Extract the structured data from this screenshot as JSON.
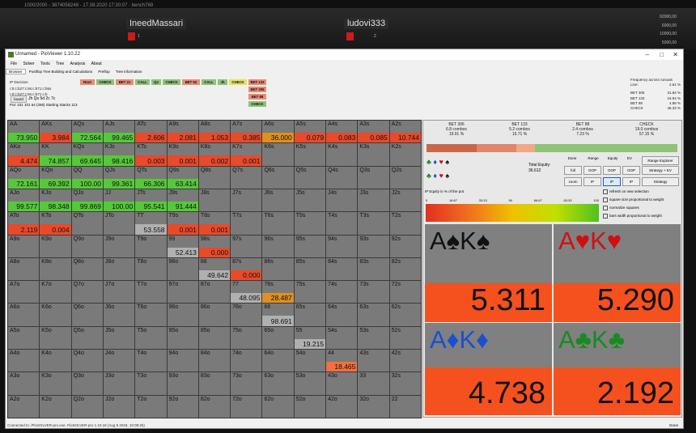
{
  "window_info": "1000/2000 - 3874058248 - 17.08.2020 17:30:07 - bench769",
  "players": [
    {
      "name": "IneedMassari",
      "amount": "1"
    },
    {
      "name": "ludovi333",
      "amount": "2"
    }
  ],
  "stacks": [
    "62000,00",
    "6000,00",
    "10000,00",
    "5000,00"
  ],
  "app": {
    "title": "Unnamed - PioViewer 1.10.22",
    "menu": [
      "File",
      "Solver",
      "Tools",
      "Tree",
      "Analysis",
      "About"
    ],
    "tabs": [
      "Browser",
      "Postflop Tree Building and Calculations",
      "Preflop",
      "Tree information"
    ],
    "ip_decision": [
      "IP Decision",
      "r:0:c:b27:c:8s:c:b71:c:b5s",
      "r:0:c:b27:c:8s:c:b71:c:b"
    ],
    "board_button": "board",
    "board_cards": "Jh Qs 5d 2c 7c",
    "pot": "Pot: 101 101 64 (266) Starting Stacks 113",
    "action_line": [
      {
        "label": "Root",
        "color": "#e88c74"
      },
      {
        "label": "CHECK",
        "color": "#8fc27a"
      },
      {
        "label": "BET 21",
        "color": "#e88c74"
      },
      {
        "label": "CALL",
        "color": "#8fc27a"
      },
      {
        "label": "Qs",
        "color": "#8fc27a"
      },
      {
        "label": "CHECK",
        "color": "#8fc27a"
      },
      {
        "label": "BET 62",
        "color": "#e88c74"
      },
      {
        "label": "CALL",
        "color": "#8fc27a"
      },
      {
        "label": "Jh",
        "color": "#8fc27a"
      },
      {
        "label": "CHECK",
        "color": "#e8e060"
      },
      {
        "label": "BET 133",
        "color": "#e88c74"
      },
      {
        "label": "BET 306",
        "color": "#e88c74"
      },
      {
        "label": "BET 88",
        "color": "#e88c74"
      },
      {
        "label": "CHECK",
        "color": "#8fc27a"
      }
    ],
    "frequency": {
      "title": "Frequency across runouts",
      "line_label": "Line:",
      "line_value": "2.61 %",
      "rows": [
        [
          "BET 306",
          "31.84 %"
        ],
        [
          "BET 133",
          "16.94 %"
        ],
        [
          "BET 88",
          "4.88 %"
        ],
        [
          "CHECK",
          "46.33 %"
        ]
      ]
    },
    "grid": [
      [
        {
          "h": "AA",
          "v": "73.950",
          "c": "#56c83a"
        },
        {
          "h": "AKs",
          "v": "3.984",
          "c": "#e84a2a"
        },
        {
          "h": "AQs",
          "v": "72.564",
          "c": "#56c83a"
        },
        {
          "h": "AJs",
          "v": "99.465",
          "c": "#56c83a"
        },
        {
          "h": "ATs",
          "v": "2.606",
          "c": "#e84a2a"
        },
        {
          "h": "A9s",
          "v": "2.081",
          "c": "#e84a2a"
        },
        {
          "h": "A8s",
          "v": "1.053",
          "c": "#e84a2a"
        },
        {
          "h": "A7s",
          "v": "0.385",
          "c": "#e84a2a"
        },
        {
          "h": "A6s",
          "v": "36.000",
          "c": "#e09020"
        },
        {
          "h": "A5s",
          "v": "0.079",
          "c": "#e84a2a"
        },
        {
          "h": "A4s",
          "v": "0.083",
          "c": "#e84a2a"
        },
        {
          "h": "A3s",
          "v": "0.085",
          "c": "#e84a2a"
        },
        {
          "h": "A2s",
          "v": "10.744",
          "c": "#e84a2a"
        }
      ],
      [
        {
          "h": "AKo",
          "v": "4.474",
          "c": "#e84a2a"
        },
        {
          "h": "KK",
          "v": "74.857",
          "c": "#56c83a"
        },
        {
          "h": "KQs",
          "v": "69.645",
          "c": "#56c83a"
        },
        {
          "h": "KJs",
          "v": "98.416",
          "c": "#56c83a"
        },
        {
          "h": "KTs",
          "v": "0.003",
          "c": "#e84a2a"
        },
        {
          "h": "K9s",
          "v": "0.001",
          "c": "#e84a2a"
        },
        {
          "h": "K8s",
          "v": "0.002",
          "c": "#e84a2a"
        },
        {
          "h": "K7s",
          "v": "0.001",
          "c": "#e84a2a"
        },
        {
          "h": "K6s",
          "v": "",
          "c": ""
        },
        {
          "h": "K5s",
          "v": "",
          "c": ""
        },
        {
          "h": "K4s",
          "v": "",
          "c": ""
        },
        {
          "h": "K3s",
          "v": "",
          "c": ""
        },
        {
          "h": "K2s",
          "v": "",
          "c": ""
        }
      ],
      [
        {
          "h": "AQo",
          "v": "72.161",
          "c": "#56c83a"
        },
        {
          "h": "KQo",
          "v": "69.392",
          "c": "#56c83a"
        },
        {
          "h": "QQ",
          "v": "100.00",
          "c": "#56c83a"
        },
        {
          "h": "QJs",
          "v": "99.361",
          "c": "#56c83a"
        },
        {
          "h": "QTs",
          "v": "66.306",
          "c": "#56c83a"
        },
        {
          "h": "Q9s",
          "v": "63.414",
          "c": "#56c83a"
        },
        {
          "h": "Q8s",
          "v": "",
          "c": ""
        },
        {
          "h": "Q7s",
          "v": "",
          "c": ""
        },
        {
          "h": "Q6s",
          "v": "",
          "c": ""
        },
        {
          "h": "Q5s",
          "v": "",
          "c": ""
        },
        {
          "h": "Q4s",
          "v": "",
          "c": ""
        },
        {
          "h": "Q3s",
          "v": "",
          "c": ""
        },
        {
          "h": "Q2s",
          "v": "",
          "c": ""
        }
      ],
      [
        {
          "h": "AJo",
          "v": "99.577",
          "c": "#56c83a"
        },
        {
          "h": "KJo",
          "v": "98.348",
          "c": "#56c83a"
        },
        {
          "h": "QJo",
          "v": "99.869",
          "c": "#56c83a"
        },
        {
          "h": "JJ",
          "v": "100.00",
          "c": "#56c83a"
        },
        {
          "h": "JTs",
          "v": "95.541",
          "c": "#56c83a"
        },
        {
          "h": "J9s",
          "v": "91.444",
          "c": "#56c83a"
        },
        {
          "h": "J8s",
          "v": "",
          "c": ""
        },
        {
          "h": "J7s",
          "v": "",
          "c": ""
        },
        {
          "h": "J6s",
          "v": "",
          "c": ""
        },
        {
          "h": "J5s",
          "v": "",
          "c": ""
        },
        {
          "h": "J4s",
          "v": "",
          "c": ""
        },
        {
          "h": "J3s",
          "v": "",
          "c": ""
        },
        {
          "h": "J2s",
          "v": "",
          "c": ""
        }
      ],
      [
        {
          "h": "ATo",
          "v": "2.119",
          "c": "#e84a2a"
        },
        {
          "h": "KTo",
          "v": "0.004",
          "c": "#e84a2a"
        },
        {
          "h": "QTo",
          "v": "",
          "c": ""
        },
        {
          "h": "JTo",
          "v": "",
          "c": ""
        },
        {
          "h": "TT",
          "v": "53.558",
          "c": "#b0b0b0"
        },
        {
          "h": "T9s",
          "v": "0.001",
          "c": "#e84a2a"
        },
        {
          "h": "T8s",
          "v": "0.001",
          "c": "#e84a2a"
        },
        {
          "h": "T7s",
          "v": "",
          "c": ""
        },
        {
          "h": "T6s",
          "v": "",
          "c": ""
        },
        {
          "h": "T5s",
          "v": "",
          "c": ""
        },
        {
          "h": "T4s",
          "v": "",
          "c": ""
        },
        {
          "h": "T3s",
          "v": "",
          "c": ""
        },
        {
          "h": "T2s",
          "v": "",
          "c": ""
        }
      ],
      [
        {
          "h": "A9o",
          "v": "",
          "c": ""
        },
        {
          "h": "K9o",
          "v": "",
          "c": ""
        },
        {
          "h": "Q9o",
          "v": "",
          "c": ""
        },
        {
          "h": "J9o",
          "v": "",
          "c": ""
        },
        {
          "h": "T9o",
          "v": "",
          "c": ""
        },
        {
          "h": "99",
          "v": "52.413",
          "c": "#b0b0b0"
        },
        {
          "h": "98s",
          "v": "0.000",
          "c": "#e84a2a"
        },
        {
          "h": "97s",
          "v": "",
          "c": ""
        },
        {
          "h": "96s",
          "v": "",
          "c": ""
        },
        {
          "h": "95s",
          "v": "",
          "c": ""
        },
        {
          "h": "94s",
          "v": "",
          "c": ""
        },
        {
          "h": "93s",
          "v": "",
          "c": ""
        },
        {
          "h": "92s",
          "v": "",
          "c": ""
        }
      ],
      [
        {
          "h": "A8o",
          "v": "",
          "c": ""
        },
        {
          "h": "K8o",
          "v": "",
          "c": ""
        },
        {
          "h": "Q8o",
          "v": "",
          "c": ""
        },
        {
          "h": "J8o",
          "v": "",
          "c": ""
        },
        {
          "h": "T8o",
          "v": "",
          "c": ""
        },
        {
          "h": "98o",
          "v": "",
          "c": ""
        },
        {
          "h": "88",
          "v": "49.642",
          "c": "#b0b0b0"
        },
        {
          "h": "87s",
          "v": "0.000",
          "c": "#e84a2a"
        },
        {
          "h": "86s",
          "v": "",
          "c": ""
        },
        {
          "h": "85s",
          "v": "",
          "c": ""
        },
        {
          "h": "84s",
          "v": "",
          "c": ""
        },
        {
          "h": "83s",
          "v": "",
          "c": ""
        },
        {
          "h": "82s",
          "v": "",
          "c": ""
        }
      ],
      [
        {
          "h": "A7o",
          "v": "",
          "c": ""
        },
        {
          "h": "K7o",
          "v": "",
          "c": ""
        },
        {
          "h": "Q7o",
          "v": "",
          "c": ""
        },
        {
          "h": "J7o",
          "v": "",
          "c": ""
        },
        {
          "h": "T7o",
          "v": "",
          "c": ""
        },
        {
          "h": "97o",
          "v": "",
          "c": ""
        },
        {
          "h": "87o",
          "v": "",
          "c": ""
        },
        {
          "h": "77",
          "v": "48.095",
          "c": "#b0b0b0"
        },
        {
          "h": "76s",
          "v": "28.487",
          "c": "#e09020"
        },
        {
          "h": "75s",
          "v": "",
          "c": ""
        },
        {
          "h": "74s",
          "v": "",
          "c": ""
        },
        {
          "h": "73s",
          "v": "",
          "c": ""
        },
        {
          "h": "72s",
          "v": "",
          "c": ""
        }
      ],
      [
        {
          "h": "A6o",
          "v": "",
          "c": ""
        },
        {
          "h": "K6o",
          "v": "",
          "c": ""
        },
        {
          "h": "Q6o",
          "v": "",
          "c": ""
        },
        {
          "h": "J6o",
          "v": "",
          "c": ""
        },
        {
          "h": "T6o",
          "v": "",
          "c": ""
        },
        {
          "h": "96o",
          "v": "",
          "c": ""
        },
        {
          "h": "86o",
          "v": "",
          "c": ""
        },
        {
          "h": "76o",
          "v": "",
          "c": ""
        },
        {
          "h": "66",
          "v": "98.691",
          "c": "#b0b0b0"
        },
        {
          "h": "65s",
          "v": "",
          "c": ""
        },
        {
          "h": "64s",
          "v": "",
          "c": ""
        },
        {
          "h": "63s",
          "v": "",
          "c": ""
        },
        {
          "h": "62s",
          "v": "",
          "c": ""
        }
      ],
      [
        {
          "h": "A5o",
          "v": "",
          "c": ""
        },
        {
          "h": "K5o",
          "v": "",
          "c": ""
        },
        {
          "h": "Q5o",
          "v": "",
          "c": ""
        },
        {
          "h": "J5o",
          "v": "",
          "c": ""
        },
        {
          "h": "T5o",
          "v": "",
          "c": ""
        },
        {
          "h": "95o",
          "v": "",
          "c": ""
        },
        {
          "h": "85o",
          "v": "",
          "c": ""
        },
        {
          "h": "75o",
          "v": "",
          "c": ""
        },
        {
          "h": "65o",
          "v": "",
          "c": ""
        },
        {
          "h": "55",
          "v": "19.215",
          "c": "#b0b0b0"
        },
        {
          "h": "54s",
          "v": "",
          "c": ""
        },
        {
          "h": "53s",
          "v": "",
          "c": ""
        },
        {
          "h": "52s",
          "v": "",
          "c": ""
        }
      ],
      [
        {
          "h": "A4o",
          "v": "",
          "c": ""
        },
        {
          "h": "K4o",
          "v": "",
          "c": ""
        },
        {
          "h": "Q4o",
          "v": "",
          "c": ""
        },
        {
          "h": "J4o",
          "v": "",
          "c": ""
        },
        {
          "h": "T4o",
          "v": "",
          "c": ""
        },
        {
          "h": "94o",
          "v": "",
          "c": ""
        },
        {
          "h": "84o",
          "v": "",
          "c": ""
        },
        {
          "h": "74o",
          "v": "",
          "c": ""
        },
        {
          "h": "64o",
          "v": "",
          "c": ""
        },
        {
          "h": "54o",
          "v": "",
          "c": ""
        },
        {
          "h": "44",
          "v": "18.465",
          "c": "#f07040"
        },
        {
          "h": "43s",
          "v": "",
          "c": ""
        },
        {
          "h": "42s",
          "v": "",
          "c": ""
        }
      ],
      [
        {
          "h": "A3o",
          "v": "",
          "c": ""
        },
        {
          "h": "K3o",
          "v": "",
          "c": ""
        },
        {
          "h": "Q3o",
          "v": "",
          "c": ""
        },
        {
          "h": "J3o",
          "v": "",
          "c": ""
        },
        {
          "h": "T3o",
          "v": "",
          "c": ""
        },
        {
          "h": "93o",
          "v": "",
          "c": ""
        },
        {
          "h": "83o",
          "v": "",
          "c": ""
        },
        {
          "h": "73o",
          "v": "",
          "c": ""
        },
        {
          "h": "63o",
          "v": "",
          "c": ""
        },
        {
          "h": "53o",
          "v": "",
          "c": ""
        },
        {
          "h": "43o",
          "v": "",
          "c": ""
        },
        {
          "h": "33",
          "v": "",
          "c": ""
        },
        {
          "h": "32s",
          "v": "",
          "c": ""
        }
      ],
      [
        {
          "h": "A2o",
          "v": "",
          "c": ""
        },
        {
          "h": "K2o",
          "v": "",
          "c": ""
        },
        {
          "h": "Q2o",
          "v": "",
          "c": ""
        },
        {
          "h": "J2o",
          "v": "",
          "c": ""
        },
        {
          "h": "T2o",
          "v": "",
          "c": ""
        },
        {
          "h": "92o",
          "v": "",
          "c": ""
        },
        {
          "h": "82o",
          "v": "",
          "c": ""
        },
        {
          "h": "72o",
          "v": "",
          "c": ""
        },
        {
          "h": "62o",
          "v": "",
          "c": ""
        },
        {
          "h": "52o",
          "v": "",
          "c": ""
        },
        {
          "h": "42o",
          "v": "",
          "c": ""
        },
        {
          "h": "32o",
          "v": "",
          "c": ""
        },
        {
          "h": "22",
          "v": "",
          "c": ""
        }
      ]
    ],
    "actions_summary": [
      {
        "name": "BET 306",
        "combos": "6.8 combos",
        "pct": "19.91 %",
        "color": "#c8674a"
      },
      {
        "name": "BET 133",
        "combos": "5.2 combos",
        "pct": "15.71 %",
        "color": "#e0866a"
      },
      {
        "name": "BET 88",
        "combos": "2.4 combos",
        "pct": "7.23 %",
        "color": "#f0a888"
      },
      {
        "name": "CHECK",
        "combos": "19.0 combos",
        "pct": "57.15 %",
        "color": "#8fc27a"
      }
    ],
    "total_equity_label": "Total Equity:",
    "total_equity": "36.612",
    "ip_equity_label": "IP Equity in % of the pot",
    "scale": [
      "0",
      "16.67",
      "33.33",
      "50",
      "66.67",
      "83.33",
      "100"
    ],
    "tools": [
      "Done",
      "Range",
      "Equity",
      "EV",
      "Range Explorer",
      "full",
      "OOP",
      "OOP",
      "OOP",
      "Strategy + EV",
      "zoom",
      "IP",
      "IP",
      "IP",
      "Strategy"
    ],
    "checkboxes": [
      "refresh on new selection",
      "square size proportional to weight",
      "normalize squares",
      "bars width proportional to weight"
    ],
    "hands": [
      {
        "cards": "A♠K♠",
        "value": "5.311",
        "suit": "#111"
      },
      {
        "cards": "A♥K♥",
        "value": "5.290",
        "suit": "#d01010"
      },
      {
        "cards": "A♦K♦",
        "value": "4.738",
        "suit": "#1a4fd0"
      },
      {
        "cards": "A♣K♣",
        "value": "2.192",
        "suit": "#1a8a20"
      }
    ],
    "status": "Connected to: /PioSOLVER-pro.exe, PioSOLVER-pro 1.10.18 (Aug  9 2018, 10:08:25)",
    "done": "Done"
  }
}
